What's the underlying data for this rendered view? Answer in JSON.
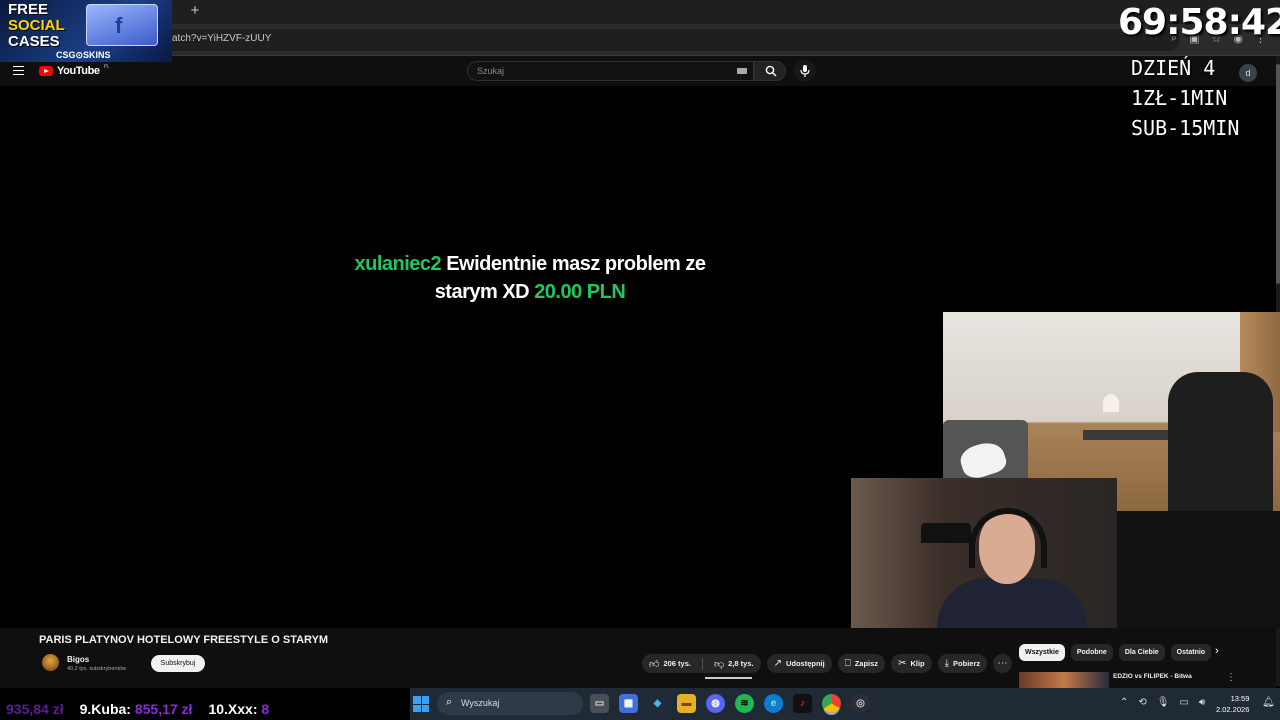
{
  "browser": {
    "url_fragment": "atch?v=YiHZVF-zUUY",
    "new_tab": "+",
    "tab_close": "×"
  },
  "youtube": {
    "logo_text": "YouTube",
    "country_code": "PL",
    "search_placeholder": "Szukaj",
    "avatar_letter": "d"
  },
  "donation": {
    "user": "xulaniec2",
    "message_line1": "Ewidentnie masz problem ze",
    "message_line2": "starym XD",
    "amount": "20.00 PLN"
  },
  "overlay": {
    "promo": {
      "line1": "FREE",
      "line2": "SOCIAL",
      "line3": "CASES",
      "brand": "CSG⊙SKINS"
    },
    "timer": "69:58:42",
    "info": [
      "DZIEŃ 4",
      "1ZŁ-1MIN",
      "SUB-15MIN"
    ]
  },
  "video": {
    "title": "PARIS PLATYNOV HOTELOWY FREESTYLE O STARYM",
    "channel": "Bigos",
    "subscribers": "40,2 tys. subskrybentów",
    "subscribe_label": "Subskrybuj",
    "likes": "206 tys.",
    "dislikes": "2,8 tys.",
    "share": "Udostępnij",
    "save": "Zapisz",
    "clip": "Klip",
    "download": "Pobierz"
  },
  "chips": [
    "Wszystkie",
    "Podobne",
    "Dla Ciebie",
    "Ostatnio"
  ],
  "recommendation": {
    "title": "EDZIO vs FILIPEK - Bitwa"
  },
  "leaderboard": {
    "entry8_amount": "935,84 zł",
    "entry9_name": "9.Kuba:",
    "entry9_amount": "855,17 zł",
    "entry10_name": "10.Xxx:",
    "entry10_amount": "8"
  },
  "taskbar": {
    "search_label": "Wyszukaj",
    "time": "13:59",
    "date": "2.02.2026"
  },
  "colors": {
    "donation_green": "#22c55e",
    "leaderboard_purple": "#8b2bd9",
    "youtube_red": "#ff0000"
  }
}
